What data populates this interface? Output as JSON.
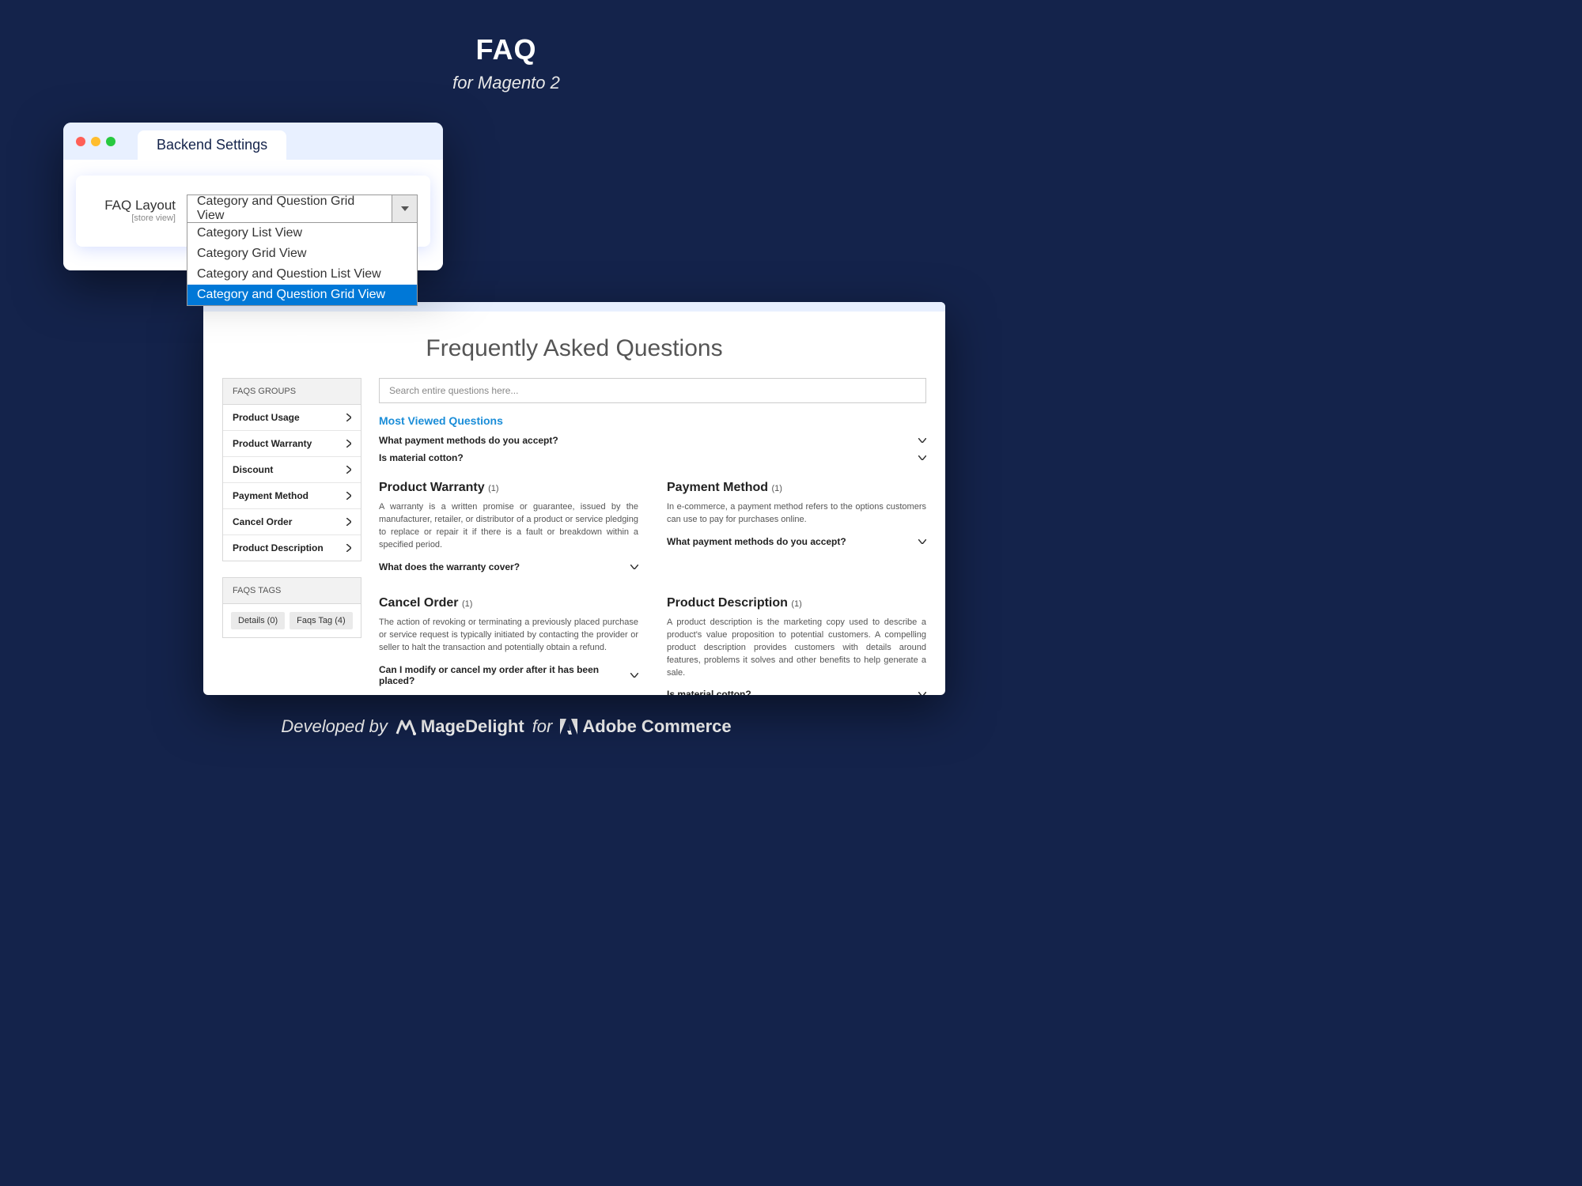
{
  "header": {
    "title": "FAQ",
    "subtitle": "for Magento 2"
  },
  "backend": {
    "tab_label": "Backend Settings",
    "field_label": "FAQ Layout",
    "field_scope": "[store view]",
    "selected_value": "Category and Question Grid View",
    "options": [
      "Category List View",
      "Category Grid View",
      "Category and Question List View",
      "Category and Question Grid View"
    ]
  },
  "frontend": {
    "title": "Frequently Asked Questions",
    "search_placeholder": "Search entire questions here...",
    "groups_header": "FAQS GROUPS",
    "groups": [
      "Product Usage",
      "Product Warranty",
      "Discount",
      "Payment Method",
      "Cancel Order",
      "Product Description"
    ],
    "tags_header": "FAQS TAGS",
    "tags": [
      "Details (0)",
      "Faqs Tag (4)"
    ],
    "most_viewed_label": "Most Viewed Questions",
    "most_viewed": [
      "What payment methods do you accept?",
      "Is material cotton?"
    ],
    "categories": [
      {
        "title": "Product Warranty",
        "count": "(1)",
        "desc": "A warranty is a written promise or guarantee, issued by the manufacturer, retailer, or distributor of a product or service pledging to replace or repair it if there is a fault or breakdown within a specified period.",
        "question": "What does the warranty cover?"
      },
      {
        "title": "Payment Method",
        "count": "(1)",
        "desc": "In e-commerce, a payment method refers to the options customers can use to pay for purchases online.",
        "question": "What payment methods do you accept?"
      },
      {
        "title": "Cancel Order",
        "count": "(1)",
        "desc": "The action of revoking or terminating a previously placed purchase or service request is typically initiated by contacting the provider or seller to halt the transaction and potentially obtain a refund.",
        "question": "Can I modify or cancel my order after it has been placed?"
      },
      {
        "title": "Product Description",
        "count": "(1)",
        "desc": "A product description is the marketing copy used to describe a product's value proposition to potential customers. A compelling product description provides customers with details around features, problems it solves and other benefits to help generate a sale.",
        "question": "Is material cotton?"
      }
    ]
  },
  "footer": {
    "developed": "Developed by",
    "brand1": "MageDelight",
    "for": "for",
    "brand2": "Adobe Commerce"
  }
}
